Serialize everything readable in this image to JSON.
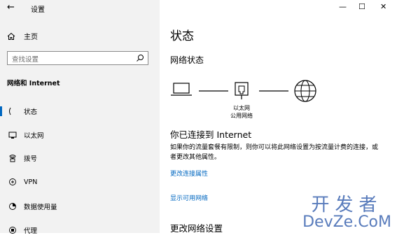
{
  "window": {
    "title": "设置",
    "minimize": "—",
    "maximize": "☐",
    "close": "✕"
  },
  "sidebar": {
    "home": "主页",
    "search_placeholder": "查找设置",
    "section": "网络和 Internet",
    "items": [
      {
        "label": "状态",
        "icon": "status-icon",
        "active": true
      },
      {
        "label": "以太网",
        "icon": "ethernet-icon"
      },
      {
        "label": "拨号",
        "icon": "dialup-icon"
      },
      {
        "label": "VPN",
        "icon": "vpn-icon"
      },
      {
        "label": "数据使用量",
        "icon": "data-usage-icon"
      },
      {
        "label": "代理",
        "icon": "proxy-icon"
      }
    ]
  },
  "main": {
    "title": "状态",
    "network_status": "网络状态",
    "ethernet_label_1": "以太网",
    "ethernet_label_2": "公用网络",
    "connected": "你已连接到 Internet",
    "description": "如果你的流量套餐有限制，则你可以将此网络设置为按流量计费的连接，或者更改其他属性。",
    "change_props": "更改连接属性",
    "show_networks": "显示可用网络",
    "change_settings": "更改网络设置"
  },
  "watermark": {
    "cn": "开发者",
    "en": "DevZe.CoM"
  }
}
